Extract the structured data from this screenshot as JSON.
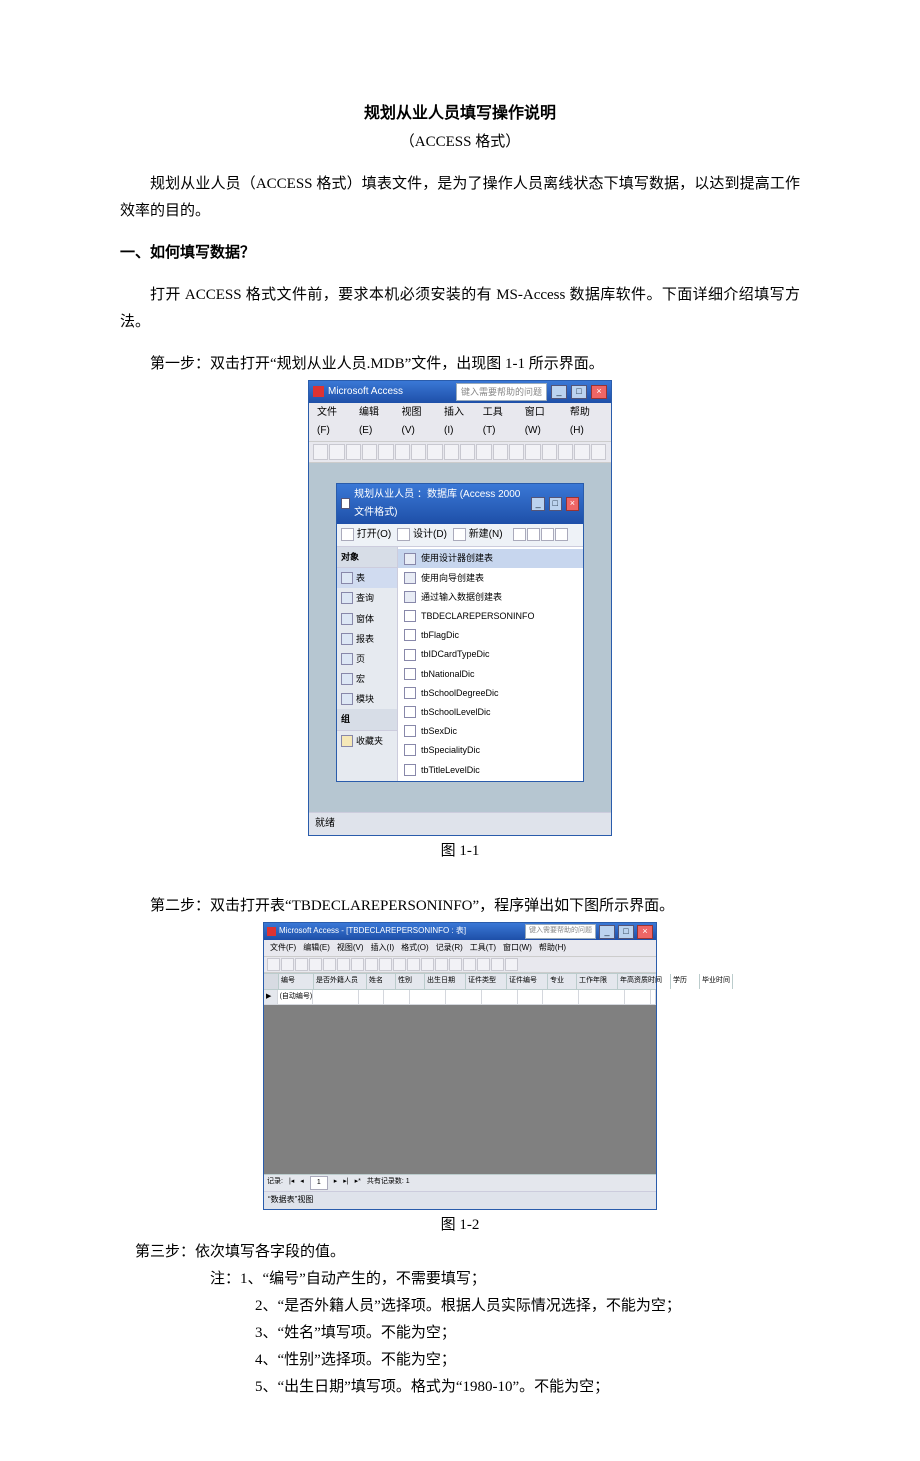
{
  "doc": {
    "title": "规划从业人员填写操作说明",
    "subtitle": "（ACCESS 格式）",
    "intro": "规划从业人员（ACCESS 格式）填表文件，是为了操作人员离线状态下填写数据，以达到提高工作效率的目的。",
    "section1_heading": "一、如何填写数据？",
    "section1_intro": "打开 ACCESS 格式文件前，要求本机必须安装的有 MS-Access 数据库软件。下面详细介绍填写方法。",
    "step1": "第一步：双击打开“规划从业人员.MDB”文件，出现图 1-1 所示界面。",
    "fig1_caption": "图 1-1",
    "step2": "第二步：双击打开表“TBDECLAREPERSONINFO”，程序弹出如下图所示界面。",
    "fig2_caption": "图 1-2",
    "step3": "第三步：依次填写各字段的值。",
    "notes_head": "注：1、“编号”自动产生的，不需要填写；",
    "notes": [
      "2、“是否外籍人员”选择项。根据人员实际情况选择，不能为空；",
      "3、“姓名”填写项。不能为空；",
      "4、“性别”选择项。不能为空；",
      "5、“出生日期”填写项。格式为“1980-10”。不能为空；"
    ]
  },
  "fig1": {
    "app_title": "Microsoft Access",
    "help_placeholder": "键入需要帮助的问题",
    "menus": [
      "文件(F)",
      "编辑(E)",
      "视图(V)",
      "插入(I)",
      "工具(T)",
      "窗口(W)",
      "帮助(H)"
    ],
    "db_title": "规划从业人员 ：数据库 (Access 2000 文件格式)",
    "dbtool": {
      "open": "打开(O)",
      "design": "设计(D)",
      "new": "新建(N)"
    },
    "nav_head": "对象",
    "nav_items": [
      "表",
      "查询",
      "窗体",
      "报表",
      "页",
      "宏",
      "模块"
    ],
    "nav_group": "组",
    "nav_fav": "收藏夹",
    "list": [
      "使用设计器创建表",
      "使用向导创建表",
      "通过输入数据创建表",
      "TBDECLAREPERSONINFO",
      "tbFlagDic",
      "tbIDCardTypeDic",
      "tbNationalDic",
      "tbSchoolDegreeDic",
      "tbSchoolLevelDic",
      "tbSexDic",
      "tbSpecialityDic",
      "tbTitleLevelDic"
    ],
    "status": "就绪"
  },
  "fig2": {
    "app_title": "Microsoft Access - [TBDECLAREPERSONINFO : 表]",
    "help_placeholder": "键入需要帮助的问题",
    "menus": [
      "文件(F)",
      "编辑(E)",
      "视图(V)",
      "插入(I)",
      "格式(O)",
      "记录(R)",
      "工具(T)",
      "窗口(W)",
      "帮助(H)"
    ],
    "cols": [
      "编号",
      "是否外籍人员",
      "姓名",
      "性别",
      "出生日期",
      "证件类型",
      "证件编号",
      "专业",
      "工作年限",
      "年高资质时间",
      "学历",
      "毕业时间"
    ],
    "first_cell": "(自动编号)",
    "nav_label": "记录:",
    "nav_pos": "1",
    "nav_total": "共有记录数: 1",
    "status": "“数据表”视图"
  }
}
